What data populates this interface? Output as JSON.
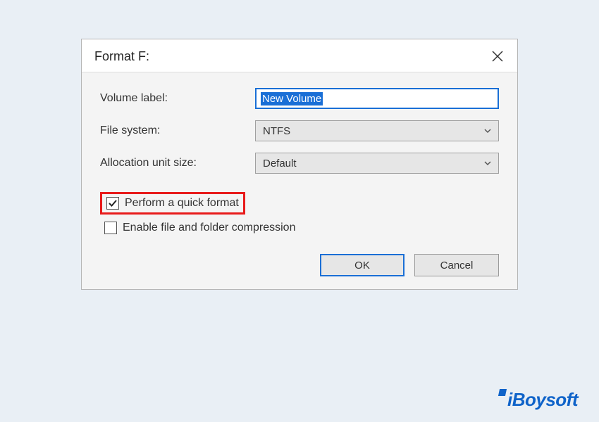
{
  "window": {
    "title": "Format F:"
  },
  "form": {
    "volume_label": {
      "label": "Volume label:",
      "value": "New Volume"
    },
    "file_system": {
      "label": "File system:",
      "selected": "NTFS"
    },
    "allocation_unit": {
      "label": "Allocation unit size:",
      "selected": "Default"
    }
  },
  "checkboxes": {
    "quick_format": {
      "label": "Perform a quick format",
      "checked": true,
      "highlighted": true
    },
    "enable_compression": {
      "label": "Enable file and folder compression",
      "checked": false
    }
  },
  "buttons": {
    "ok": "OK",
    "cancel": "Cancel"
  },
  "watermark": "iBoysoft"
}
